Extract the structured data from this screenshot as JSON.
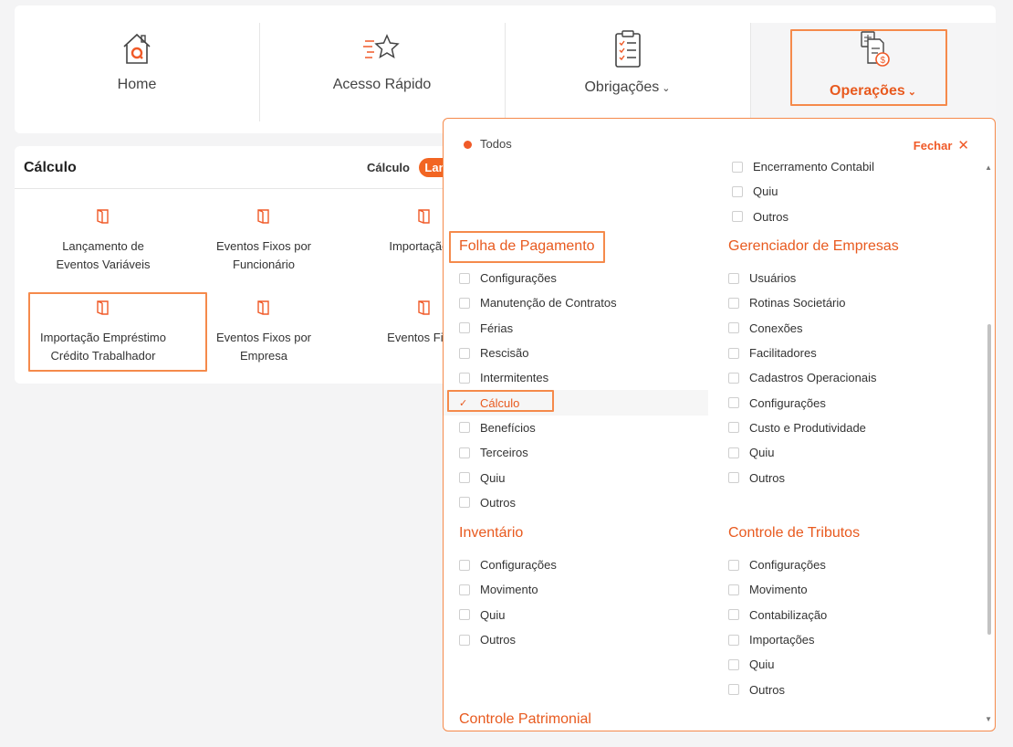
{
  "nav": {
    "home": "Home",
    "acesso": "Acesso Rápido",
    "obrigacoes": "Obrigações",
    "operacoes": "Operações",
    "chevron": "⌄"
  },
  "calc": {
    "title": "Cálculo",
    "tabs": [
      "Cálculo",
      "Lan"
    ],
    "tiles": [
      "Lançamento de Eventos Variáveis",
      "Eventos Fixos por Funcionário",
      "Importação P",
      "Importação Empréstimo Crédito Trabalhador",
      "Eventos Fixos por Empresa",
      "Eventos Fixos"
    ]
  },
  "panel": {
    "todos": "Todos",
    "fechar": "Fechar",
    "close_glyph": "✕",
    "top_right_items": [
      "Encerramento Contabil",
      "Quiu",
      "Outros"
    ],
    "folha": {
      "title": "Folha de Pagamento",
      "items": [
        "Configurações",
        "Manutenção de Contratos",
        "Férias",
        "Rescisão",
        "Intermitentes",
        "Cálculo",
        "Benefícios",
        "Terceiros",
        "Quiu",
        "Outros"
      ]
    },
    "gerenciador": {
      "title": "Gerenciador de Empresas",
      "items": [
        "Usuários",
        "Rotinas Societário",
        "Conexões",
        "Facilitadores",
        "Cadastros Operacionais",
        "Configurações",
        "Custo e Produtividade",
        "Quiu",
        "Outros"
      ]
    },
    "inventario": {
      "title": "Inventário",
      "items": [
        "Configurações",
        "Movimento",
        "Quiu",
        "Outros"
      ]
    },
    "tributos": {
      "title": "Controle de Tributos",
      "items": [
        "Configurações",
        "Movimento",
        "Contabilização",
        "Importações",
        "Quiu",
        "Outros"
      ]
    },
    "patrimonial": {
      "title": "Controle Patrimonial"
    }
  },
  "colors": {
    "accent": "#f05a28",
    "highlight": "#f58a4b"
  }
}
